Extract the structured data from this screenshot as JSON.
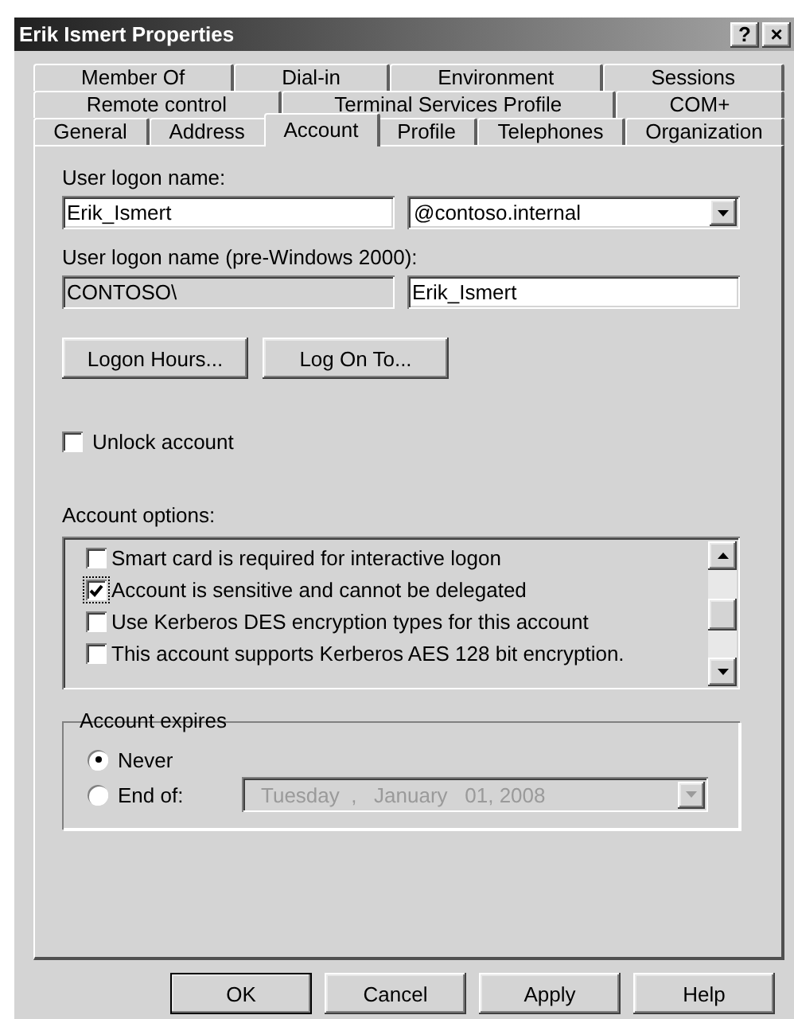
{
  "window": {
    "title": "Erik Ismert Properties",
    "buttons": [
      "?",
      "×"
    ]
  },
  "tab_rows": [
    [
      {
        "label": "Member Of",
        "selected": false
      },
      {
        "label": "Dial-in",
        "selected": false
      },
      {
        "label": "Environment",
        "selected": false
      },
      {
        "label": "Sessions",
        "selected": false
      }
    ],
    [
      {
        "label": "Remote control",
        "selected": false
      },
      {
        "label": "Terminal Services Profile",
        "selected": false
      },
      {
        "label": "COM+",
        "selected": false
      }
    ],
    [
      {
        "label": "General",
        "selected": false
      },
      {
        "label": "Address",
        "selected": false
      },
      {
        "label": "Account",
        "selected": true
      },
      {
        "label": "Profile",
        "selected": false
      },
      {
        "label": "Telephones",
        "selected": false
      },
      {
        "label": "Organization",
        "selected": false
      }
    ]
  ],
  "logon_name": {
    "label": "User logon name:",
    "value": "Erik_Ismert",
    "domain": "@contoso.internal"
  },
  "pre_2000": {
    "label": "User logon name (pre-Windows 2000):",
    "domain": "CONTOSO\\",
    "domain_disabled": true,
    "value": "Erik_Ismert"
  },
  "logon_buttons": [
    "Logon Hours...",
    "Log On To..."
  ],
  "unlock": {
    "label": "Unlock account",
    "checked": false
  },
  "account_options": {
    "label": "Account options:",
    "items": [
      {
        "label": "Smart card is required for interactive logon",
        "checked": false,
        "focused": false
      },
      {
        "label": "Account is sensitive and cannot be delegated",
        "checked": true,
        "focused": true
      },
      {
        "label": "Use Kerberos DES encryption types for this account",
        "checked": false,
        "focused": false
      },
      {
        "label": "This account supports Kerberos AES 128 bit encryption.",
        "checked": false,
        "focused": false
      }
    ]
  },
  "account_expires": {
    "title": "Account expires",
    "options": [
      {
        "label": "Never",
        "selected": true
      },
      {
        "label": "End of:",
        "selected": false
      }
    ],
    "date": {
      "value": "Tuesday  ,   January   01, 2008",
      "disabled": true
    }
  },
  "buttons": [
    {
      "label": "OK",
      "default": true
    },
    {
      "label": "Cancel",
      "default": false
    },
    {
      "label": "Apply",
      "default": false
    },
    {
      "label": "Help",
      "default": false
    }
  ]
}
